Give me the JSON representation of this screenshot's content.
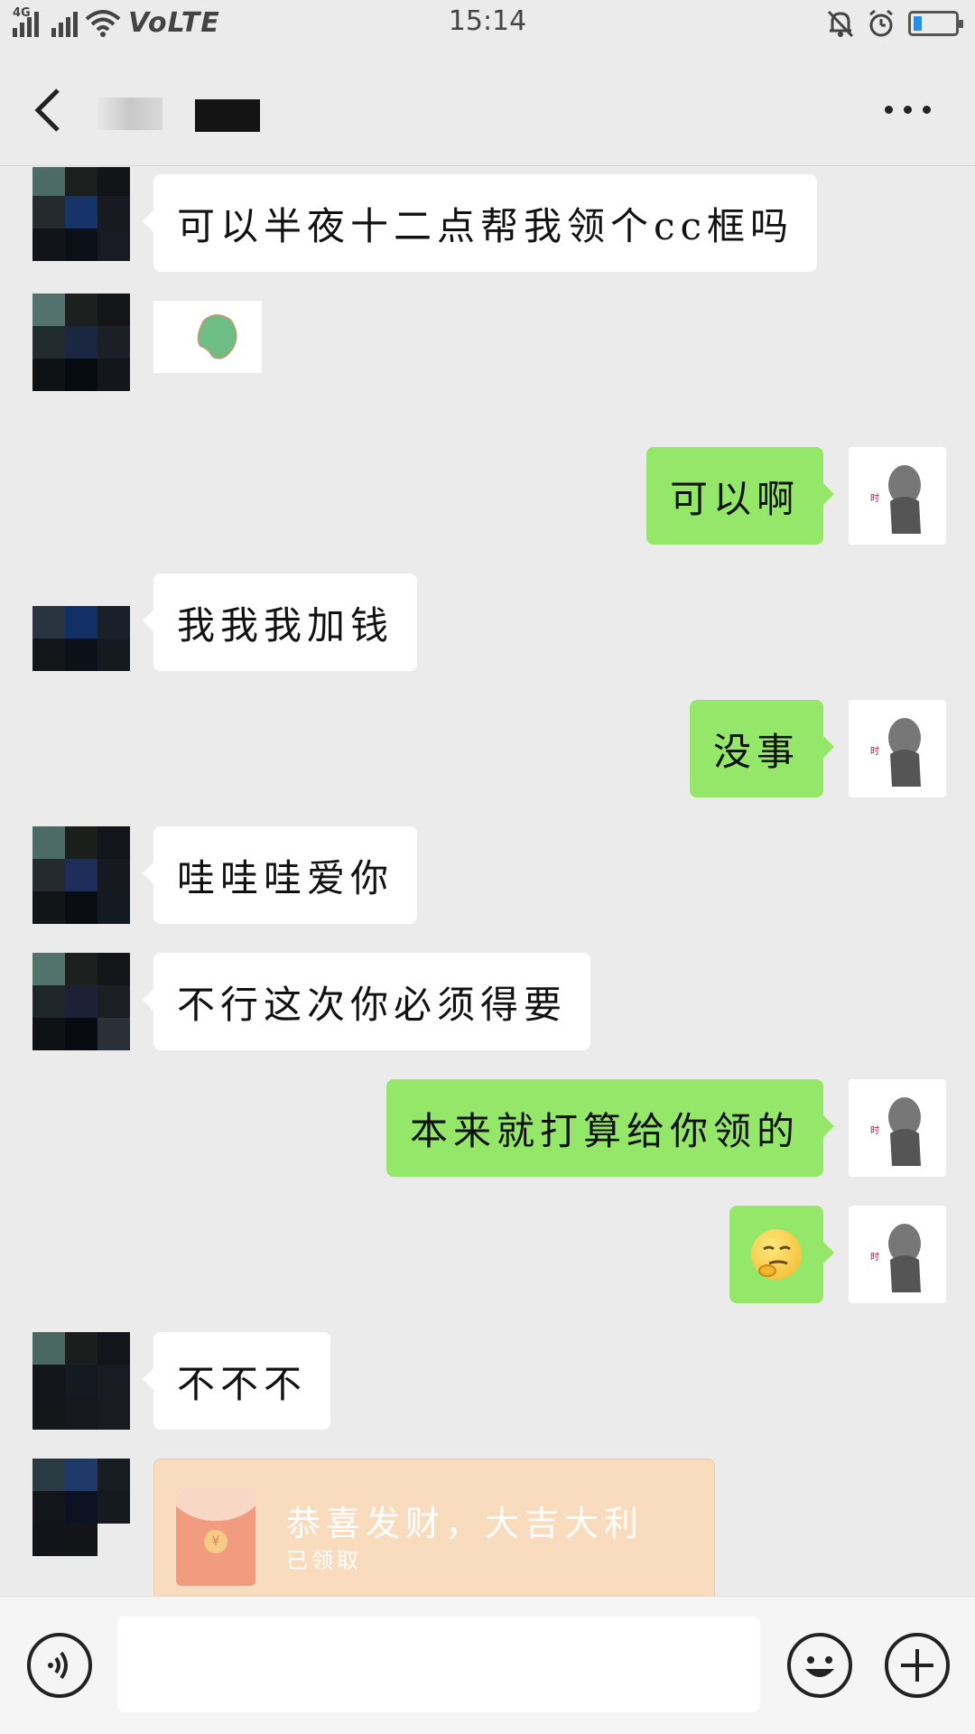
{
  "status_bar": {
    "network": "4G",
    "volte": "VoLTE",
    "time": "15:14",
    "battery_level": 0.2
  },
  "header": {
    "back_icon": "chevron-left-icon",
    "more_icon": "more-dots-icon"
  },
  "messages": [
    {
      "side": "in",
      "text": "可以半夜十二点帮我领个cc框吗"
    },
    {
      "side": "in",
      "type": "sticker"
    },
    {
      "side": "out",
      "text": "可以啊"
    },
    {
      "side": "in",
      "text": "我我我加钱"
    },
    {
      "side": "out",
      "text": "没事"
    },
    {
      "side": "in",
      "text": "哇哇哇爱你"
    },
    {
      "side": "in",
      "text": "不行这次你必须得要"
    },
    {
      "side": "out",
      "text": "本来就打算给你领的"
    },
    {
      "side": "out",
      "type": "emoji",
      "emoji": "smirking-face-emoji"
    },
    {
      "side": "in",
      "text": "不不不"
    },
    {
      "side": "in",
      "type": "red-packet",
      "title": "恭喜发财，大吉大利",
      "status": "已领取"
    }
  ],
  "colors": {
    "background": "#ebebeb",
    "bubble_out": "#95e76a",
    "bubble_in": "#ffffff",
    "red_packet": "#f9dcbd"
  },
  "bottom_bar": {
    "voice_icon": "voice-icon",
    "emoji_icon": "emoji-icon",
    "plus_icon": "plus-icon"
  }
}
